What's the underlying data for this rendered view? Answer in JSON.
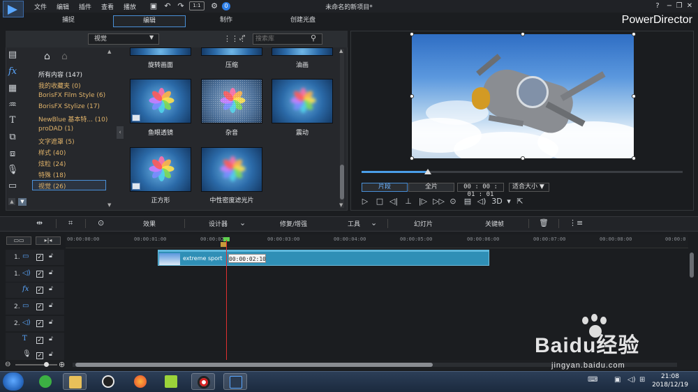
{
  "menu": {
    "file": "文件",
    "edit": "编辑",
    "plugins": "插件",
    "view": "查看",
    "playback": "播放",
    "zoom_value": "1:1",
    "user_badge": "0"
  },
  "window": {
    "doc_title": "未命名的新项目*",
    "help": "?",
    "minimize": "−",
    "restore": "❐",
    "close": "✕"
  },
  "modes": {
    "capture": "捕捉",
    "edit": "编辑",
    "produce": "制作",
    "disc": "创建光盘",
    "product_name": "PowerDirector"
  },
  "library": {
    "filter_value": "视觉",
    "search_placeholder": "搜索库",
    "categories": [
      {
        "label": "所有内容 (147)"
      },
      {
        "label": "我的收藏夹 (0)"
      },
      {
        "label": "BorisFX Film Style (6)"
      },
      {
        "label": "BorisFX Stylize (17)"
      },
      {
        "label": "NewBlue 基本特... (10)"
      },
      {
        "label": "proDAD (1)"
      },
      {
        "label": "文字遮罩 (5)"
      },
      {
        "label": "样式 (40)"
      },
      {
        "label": "炫粒 (24)"
      },
      {
        "label": "特殊 (18)"
      },
      {
        "label": "视觉 (26)"
      }
    ],
    "effects": [
      {
        "label": "旋转画面"
      },
      {
        "label": "压缩"
      },
      {
        "label": "油画"
      },
      {
        "label": "鱼眼透镜"
      },
      {
        "label": "杂音"
      },
      {
        "label": "震动"
      },
      {
        "label": "正方形"
      },
      {
        "label": "中性密度滤光片"
      }
    ]
  },
  "preview": {
    "clip_btn": "片段",
    "full_btn": "全片",
    "timecode": "00 : 00 : 01 : 01",
    "fit_value": "适合大小",
    "mode_3d": "3D"
  },
  "toolbar": {
    "effects": "效果",
    "designer": "设计器",
    "fix_enhance": "修复/增强",
    "tools": "工具",
    "slideshow": "幻灯片",
    "keyframe": "关键帧"
  },
  "timeline": {
    "ruler": [
      "00:00:00:00",
      "00:00:01:00",
      "00:00:02",
      "00:00:03:00",
      "00:00:04:00",
      "00:00:05:00",
      "00:00:06:00",
      "00:00:07:00",
      "00:00:08:00",
      "00:00:0"
    ],
    "tracks": [
      {
        "num": "1."
      },
      {
        "num": "1."
      },
      {
        "num": ""
      },
      {
        "num": "2."
      },
      {
        "num": "2."
      },
      {
        "num": ""
      },
      {
        "num": ""
      }
    ],
    "clip_label": "extreme sport",
    "tooltip_time": "00:00:02:10",
    "playhead_progress": 0.25
  },
  "taskbar": {
    "time": "21:08",
    "date": "2018/12/19"
  },
  "watermark": {
    "brand": "Baidu经验",
    "url": "jingyan.baidu.com"
  },
  "colors": {
    "accent": "#4a90d8",
    "category_text": "#e2b46a",
    "playhead": "#e03030",
    "clip": "#2f8fb6"
  }
}
